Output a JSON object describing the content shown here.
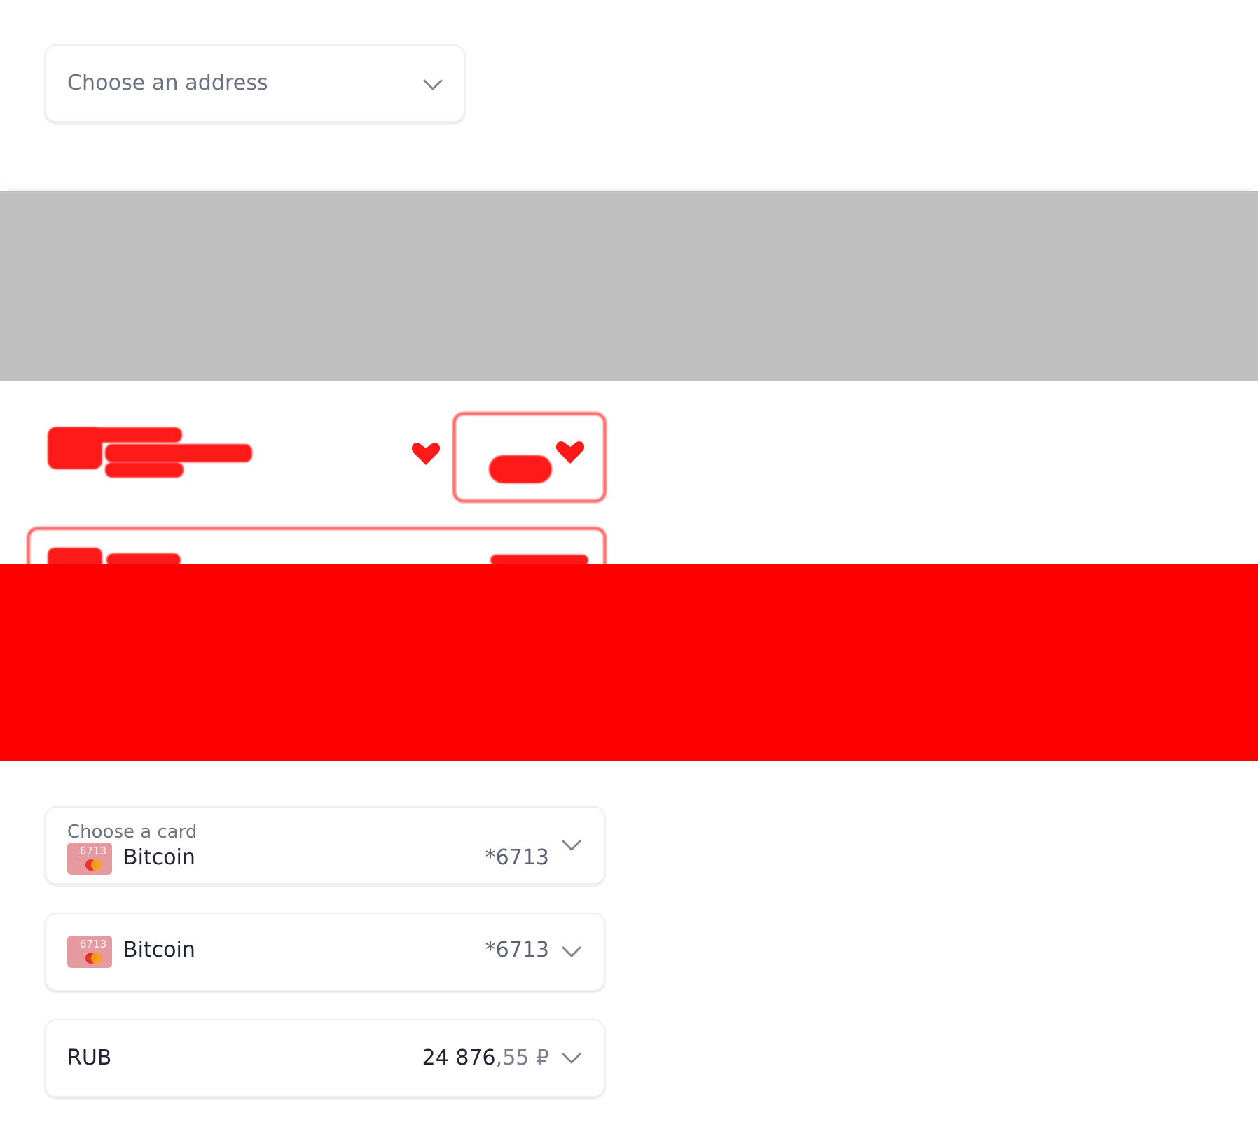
{
  "address_select": {
    "placeholder": "Choose an address",
    "icon": "chevron-down-icon"
  },
  "card_select_labeled": {
    "label": "Choose a card",
    "card": {
      "thumb_number": "6713",
      "name": "Bitcoin",
      "mask": "*6713"
    },
    "icon": "chevron-down-icon"
  },
  "card_select_plain": {
    "card": {
      "thumb_number": "6713",
      "name": "Bitcoin",
      "mask": "*6713"
    },
    "icon": "chevron-down-icon"
  },
  "currency_select": {
    "code": "RUB",
    "amount_int": "24 876",
    "amount_frac": ",55 ₽",
    "icon": "chevron-down-icon"
  },
  "colors": {
    "grey_band": "#bfbfbf",
    "red_bar": "#ff0000",
    "card_thumb": "#e59a9f",
    "text_primary": "#1f2333",
    "text_secondary": "#6c7282",
    "border": "#eceef2"
  }
}
